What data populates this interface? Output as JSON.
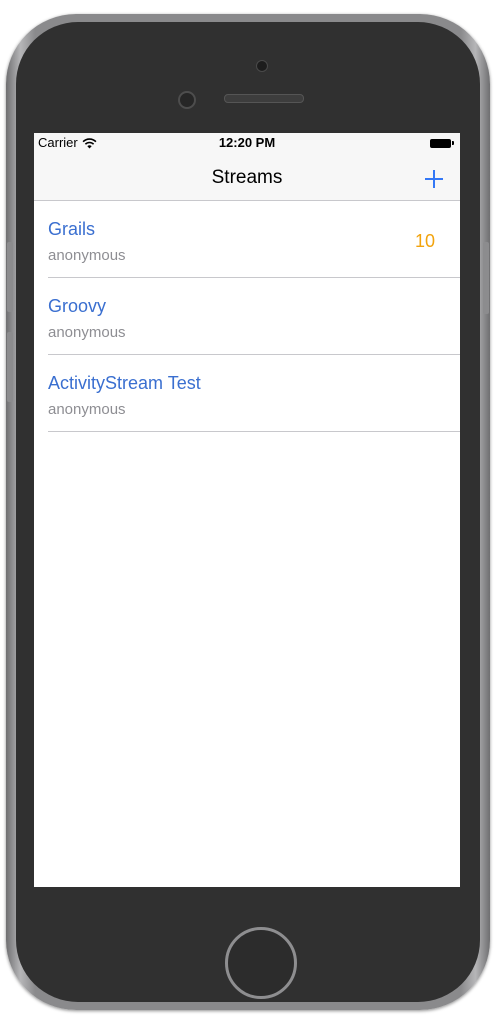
{
  "status_bar": {
    "carrier": "Carrier",
    "time": "12:20 PM",
    "wifi_icon": "wifi-icon",
    "battery_icon": "battery-icon"
  },
  "nav_bar": {
    "title": "Streams",
    "add_icon": "plus-icon"
  },
  "streams": [
    {
      "title": "Grails",
      "subtitle": "anonymous",
      "count": "10"
    },
    {
      "title": "Groovy",
      "subtitle": "anonymous",
      "count": ""
    },
    {
      "title": "ActivityStream Test",
      "subtitle": "anonymous",
      "count": ""
    }
  ],
  "colors": {
    "link_blue": "#3a6fd0",
    "badge_orange": "#f2a30d",
    "subtitle_gray": "#8e8e93",
    "tint": "#3478f6"
  }
}
